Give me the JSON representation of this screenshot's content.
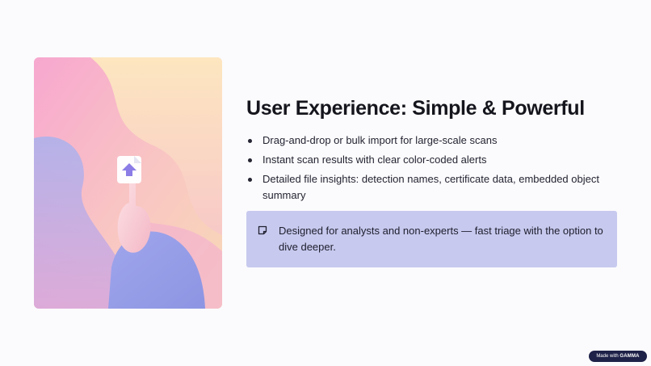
{
  "slide": {
    "title": "User Experience: Simple & Powerful",
    "bullets": [
      "Drag-and-drop or bulk import for large-scale scans",
      "Instant scan results with clear color-coded alerts",
      "Detailed file insights: detection names, certificate data, embedded object summary"
    ],
    "callout": {
      "text": "Designed for analysts and non-experts — fast triage with the option to dive deeper.",
      "icon": "sticky-note-icon"
    },
    "hero_image": {
      "description_icon": "file-upload-touch-illustration"
    }
  },
  "badge": {
    "prefix": "Made with",
    "brand": "GAMMA"
  },
  "colors": {
    "callout_background": "#c7c9ee",
    "badge_background": "#1e2148",
    "title": "#15151d",
    "body_text": "#242432"
  }
}
